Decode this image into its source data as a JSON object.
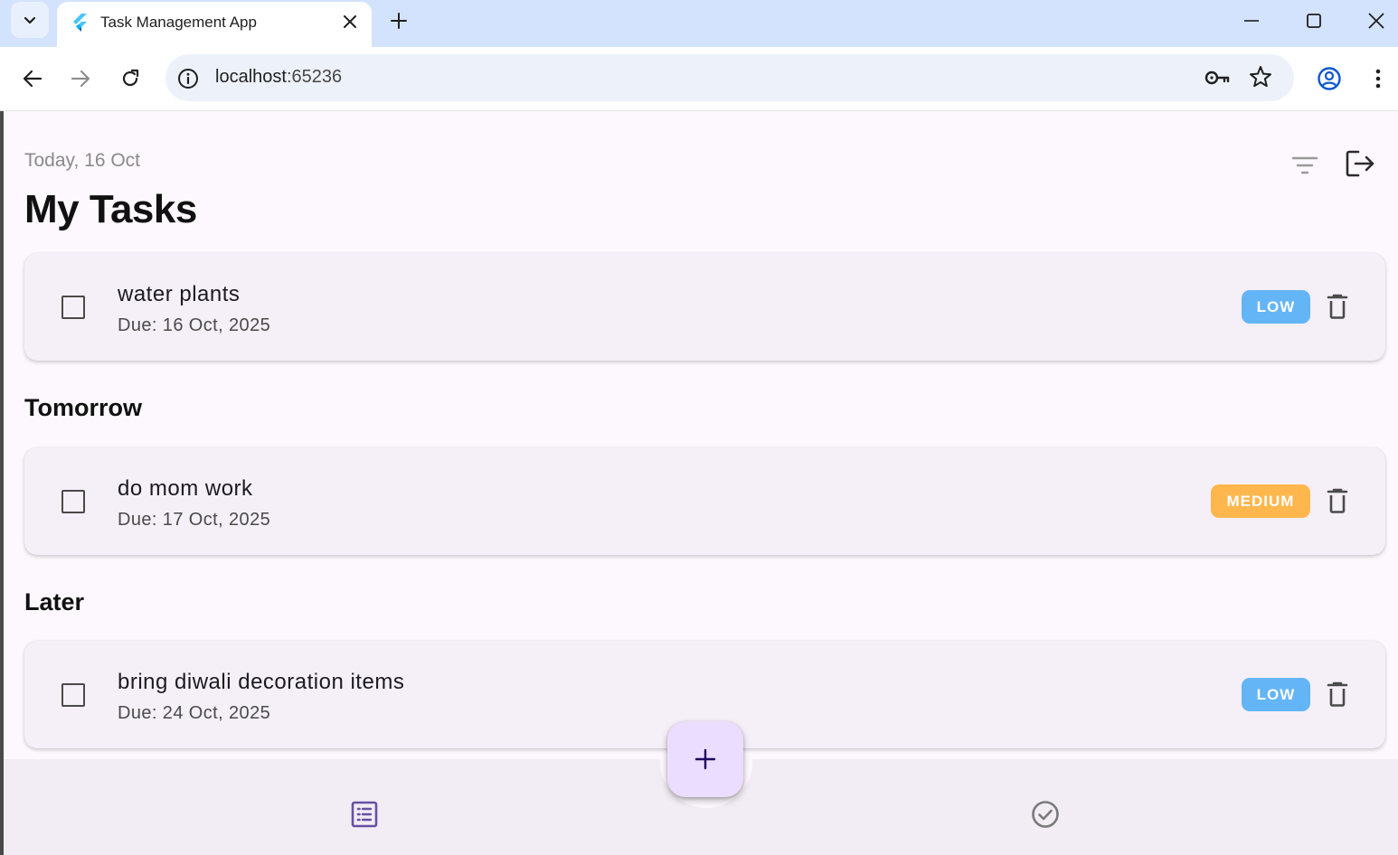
{
  "browser": {
    "tab_title": "Task Management App",
    "url_host": "localhost",
    "url_port": ":65236",
    "icons": {
      "tab_search": "chevron-down-icon",
      "favicon": "flutter-logo-icon",
      "tab_close": "close-icon",
      "new_tab": "plus-icon",
      "back": "arrow-left-icon",
      "forward": "arrow-right-icon",
      "reload": "reload-icon",
      "site_info": "info-icon",
      "password": "key-icon",
      "bookmark": "star-icon",
      "profile": "profile-icon",
      "menu": "more-vert-icon"
    }
  },
  "header": {
    "date_label": "Today, 16 Oct",
    "title": "My Tasks",
    "icons": {
      "filter": "filter-icon",
      "logout": "logout-icon"
    }
  },
  "sections": [
    {
      "heading": "",
      "tasks": [
        {
          "title": "water plants",
          "due": "Due: 16 Oct, 2025",
          "priority": "LOW",
          "priority_color": "#64b5f6",
          "completed": false
        }
      ]
    },
    {
      "heading": "Tomorrow",
      "tasks": [
        {
          "title": "do mom work",
          "due": "Due: 17 Oct, 2025",
          "priority": "MEDIUM",
          "priority_color": "#ffb74d",
          "completed": false
        }
      ]
    },
    {
      "heading": "Later",
      "tasks": [
        {
          "title": "bring diwali decoration items",
          "due": "Due: 24 Oct, 2025",
          "priority": "LOW",
          "priority_color": "#64b5f6",
          "completed": false
        }
      ]
    }
  ],
  "fab": {
    "icon": "plus-icon"
  },
  "bottom_nav": {
    "items": [
      {
        "icon": "task-list-icon",
        "active": true
      },
      {
        "icon": "check-circle-icon",
        "active": false
      }
    ]
  },
  "colors": {
    "tabbar": "#d3e3fd",
    "app_background": "#fdf8fd",
    "card": "#f5eff7",
    "accent": "#6750a4",
    "fab": "#ebddff"
  }
}
